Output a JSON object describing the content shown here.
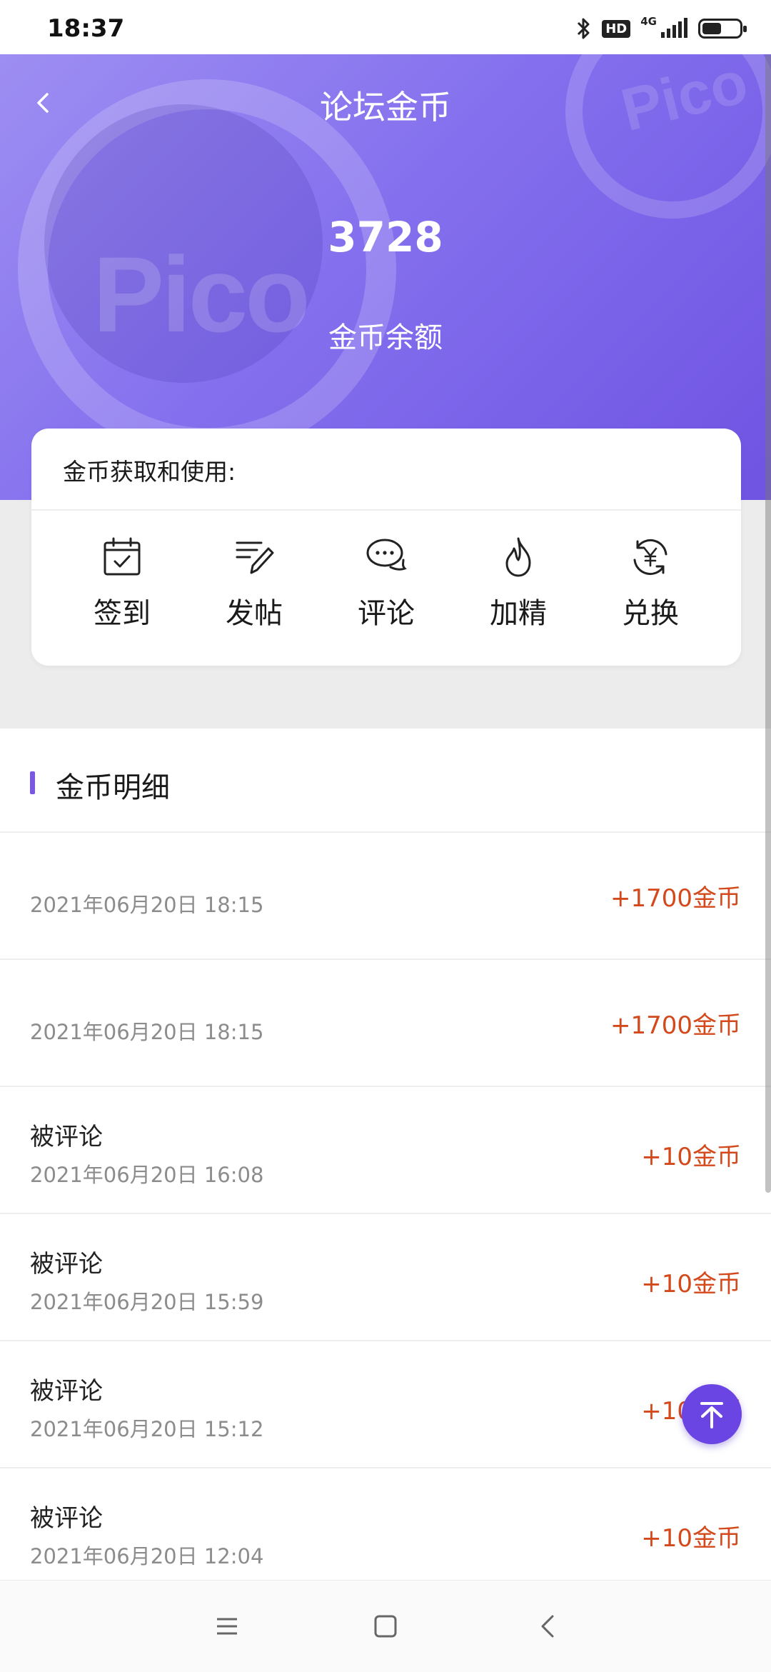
{
  "status_bar": {
    "time": "18:37",
    "network": "4G",
    "hd": "HD"
  },
  "header": {
    "title": "论坛金币",
    "balance": "3728",
    "balance_label": "金币余额",
    "watermark": "Pico",
    "accent_color": "#7b57e6"
  },
  "card": {
    "title": "金币获取和使用:",
    "actions": [
      {
        "label": "签到",
        "icon": "calendar-check-icon"
      },
      {
        "label": "发帖",
        "icon": "edit-post-icon"
      },
      {
        "label": "评论",
        "icon": "chat-bubble-icon"
      },
      {
        "label": "加精",
        "icon": "flame-icon"
      },
      {
        "label": "兑换",
        "icon": "exchange-yen-icon"
      }
    ]
  },
  "section": {
    "title": "金币明细"
  },
  "records": [
    {
      "title": "",
      "date": "2021年06月20日 18:15",
      "amount": "+1700金币"
    },
    {
      "title": "",
      "date": "2021年06月20日 18:15",
      "amount": "+1700金币"
    },
    {
      "title": "被评论",
      "date": "2021年06月20日 16:08",
      "amount": "+10金币"
    },
    {
      "title": "被评论",
      "date": "2021年06月20日 15:59",
      "amount": "+10金币"
    },
    {
      "title": "被评论",
      "date": "2021年06月20日 15:12",
      "amount": "+10金币"
    },
    {
      "title": "被评论",
      "date": "2021年06月20日 12:04",
      "amount": "+10金币"
    }
  ],
  "colors": {
    "amount": "#d4491c",
    "fab": "#6b45e3"
  },
  "nav": {
    "buttons": [
      "menu-icon",
      "home-icon",
      "back-icon"
    ]
  }
}
